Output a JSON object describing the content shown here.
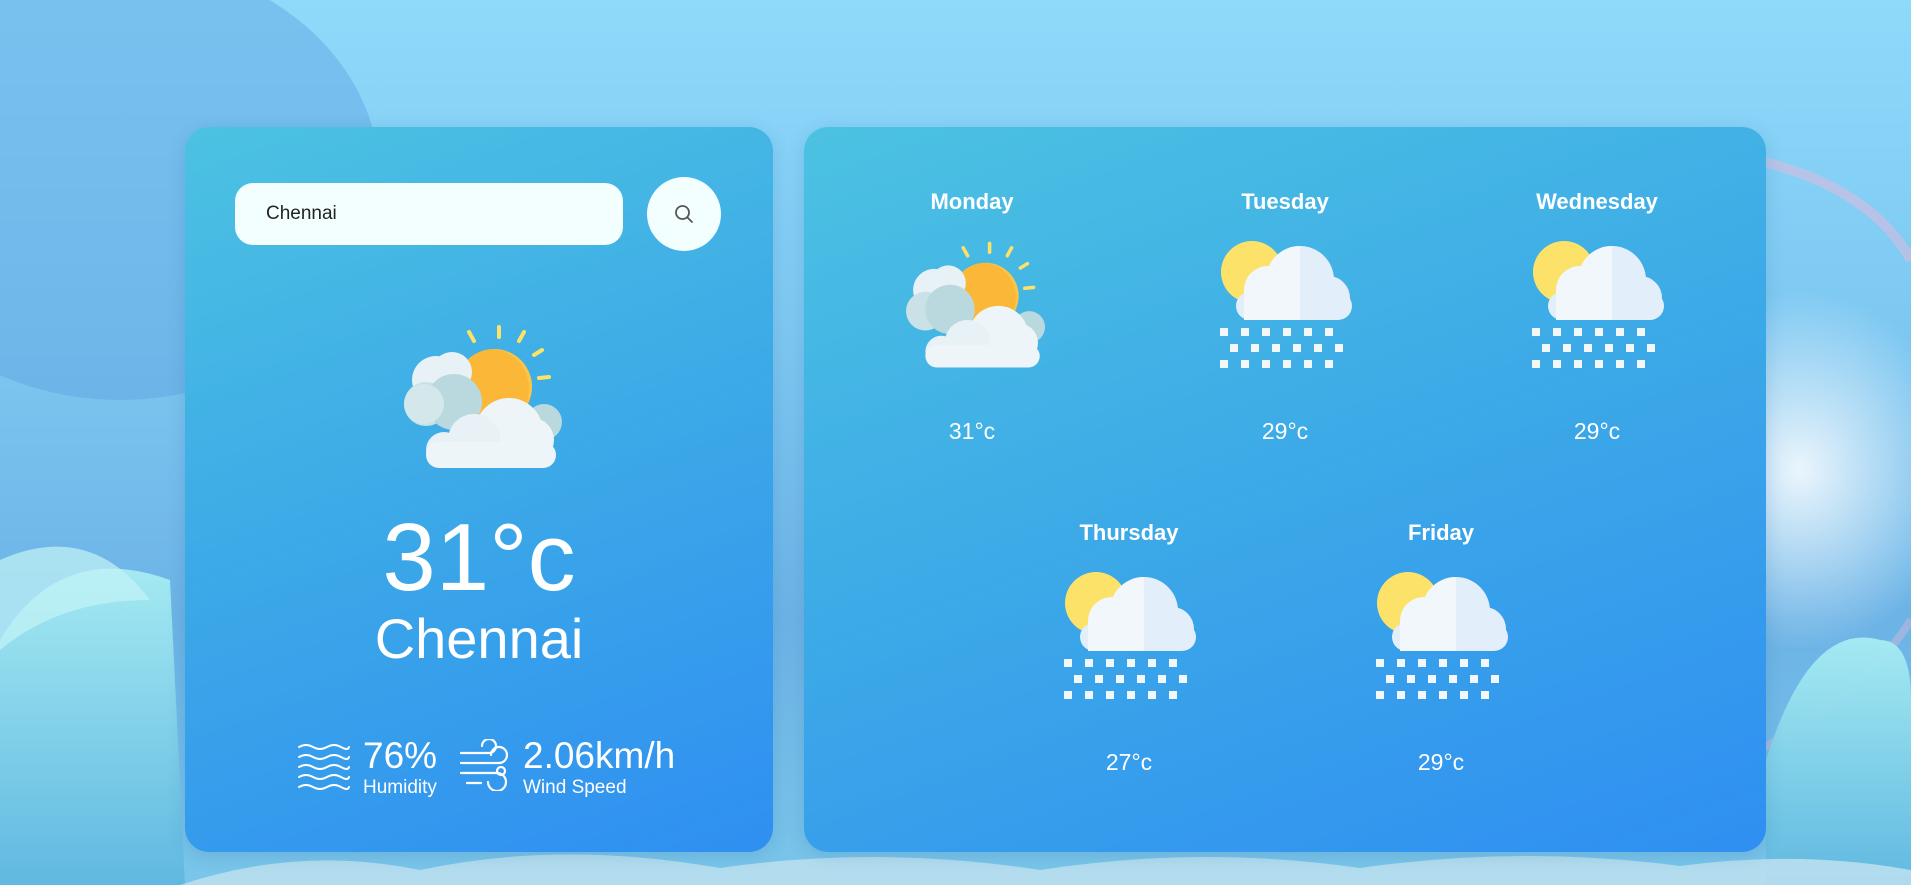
{
  "search": {
    "value": "Chennai",
    "button_icon": "search-icon"
  },
  "current": {
    "icon": "sun-cloud-icon",
    "temperature": "31°c",
    "city": "Chennai",
    "humidity": {
      "value": "76%",
      "label": "Humidity",
      "icon": "humidity-waves-icon"
    },
    "wind": {
      "value": "2.06km/h",
      "label": "Wind Speed",
      "icon": "wind-icon"
    }
  },
  "forecast": [
    {
      "day": "Monday",
      "icon": "sun-cloud-icon",
      "temp": "31°c"
    },
    {
      "day": "Tuesday",
      "icon": "snow-icon",
      "temp": "29°c"
    },
    {
      "day": "Wednesday",
      "icon": "snow-icon",
      "temp": "29°c"
    },
    {
      "day": "Thursday",
      "icon": "snow-icon",
      "temp": "27°c"
    },
    {
      "day": "Friday",
      "icon": "snow-icon",
      "temp": "29°c"
    }
  ],
  "colors": {
    "panel_start": "#4cc2e2",
    "panel_end": "#2f8ff2",
    "input_bg": "#f3fffe",
    "sun": "#fbb737",
    "snow_sun": "#fde26a",
    "cloud": "#f1f7fb",
    "text": "#ffffff"
  }
}
